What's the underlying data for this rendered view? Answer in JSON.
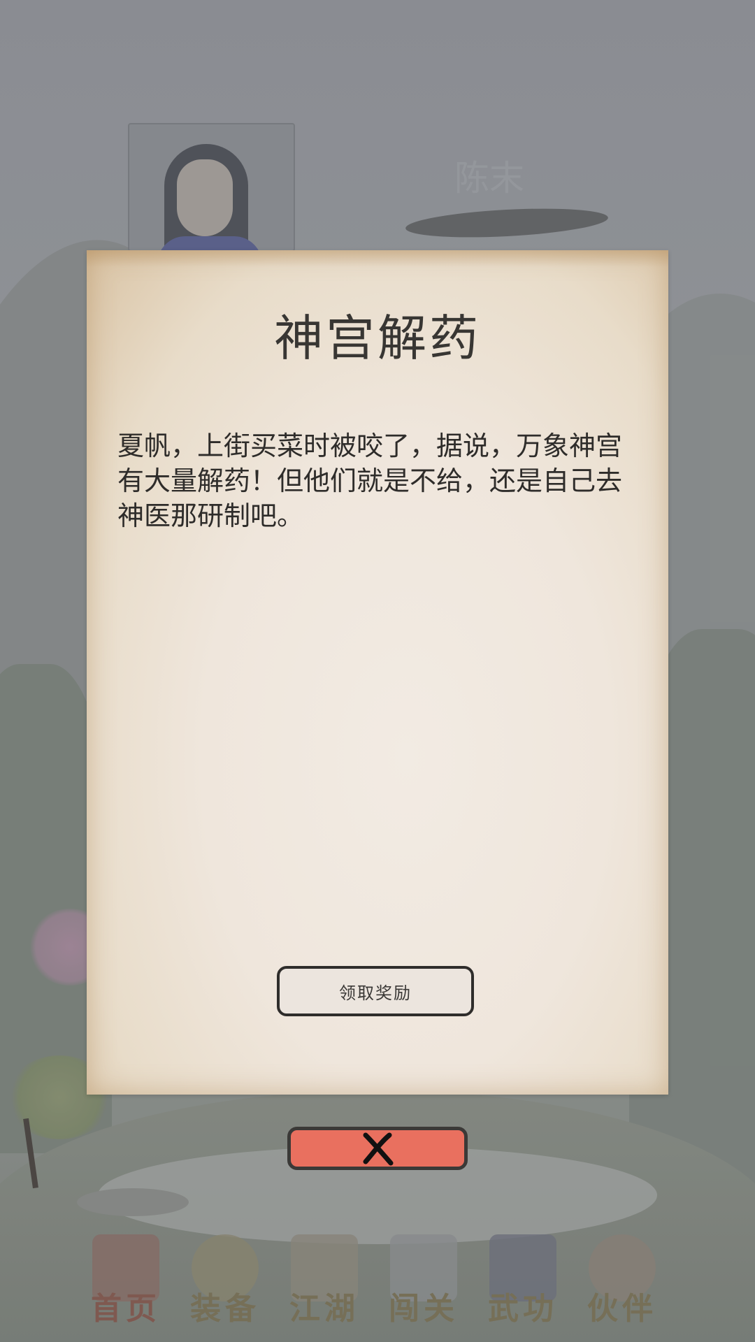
{
  "player": {
    "name": "陈末"
  },
  "dialog": {
    "title": "神宫解药",
    "body": "夏帆，上街买菜时被咬了，据说，万象神宫有大量解药！但他们就是不给，还是自己去神医那研制吧。",
    "claim_button_label": "领取奖励"
  },
  "close_button": {
    "icon": "close-icon"
  },
  "nav": {
    "active": "首页",
    "items": [
      {
        "label": "首页",
        "icon": "home-pavilion-icon"
      },
      {
        "label": "装备",
        "icon": "armor-icon"
      },
      {
        "label": "江湖",
        "icon": "scroll-icon"
      },
      {
        "label": "闯关",
        "icon": "crossed-swords-icon"
      },
      {
        "label": "武功",
        "icon": "martial-book-icon"
      },
      {
        "label": "伙伴",
        "icon": "partners-icon"
      }
    ]
  },
  "colors": {
    "dialog_paper": "#efe6dc",
    "close_button": "#e9705f",
    "title_text": "#383633"
  }
}
